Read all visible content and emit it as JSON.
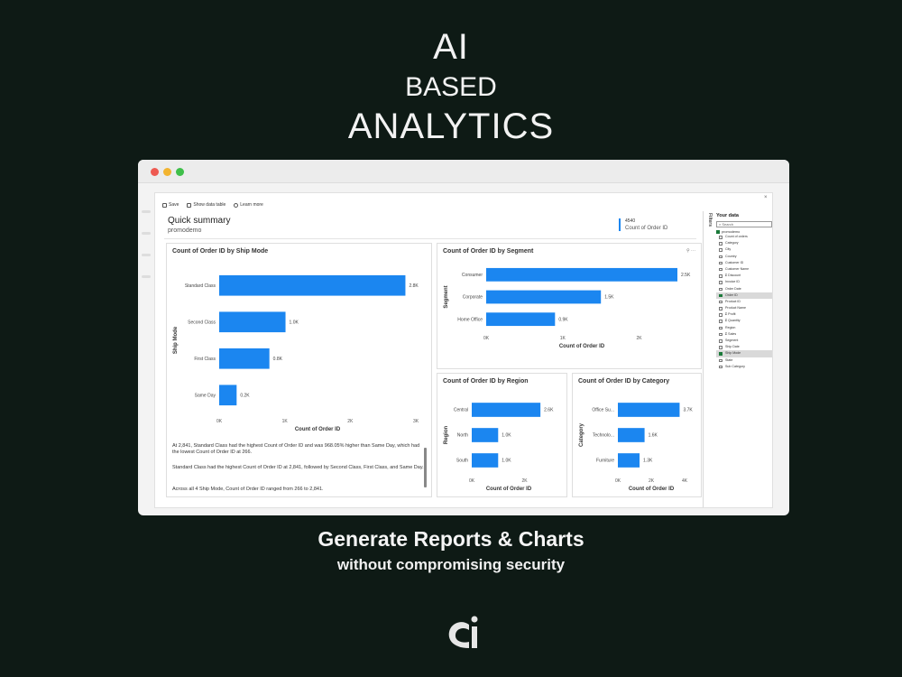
{
  "hero": {
    "line1": "AI",
    "line2": "BASED",
    "line3": "ANALYTICS"
  },
  "tagline": {
    "main": "Generate Reports & Charts",
    "sub": "without compromising security"
  },
  "colors": {
    "background": "#0e1a15",
    "bar": "#1b86f0",
    "table_icon": "#1b7a3a"
  },
  "toolbar": {
    "save": "Save",
    "show_data_table": "Show data table",
    "learn_more": "Learn more"
  },
  "summary": {
    "title": "Quick summary",
    "subtitle": "promodemo",
    "close": "×"
  },
  "kpi": {
    "value": "4540",
    "label": "Count of Order ID"
  },
  "insights": [
    "At 2,841, Standard Class had the highest Count of Order ID and was 968.05% higher than Same Day, which had the lowest Count of Order ID at 266.",
    "Standard Class had the highest Count of Order ID at 2,841, followed by Second Class, First Class, and Same Day.",
    "Across all 4 Ship Mode, Count of Order ID ranged from 266 to 2,841."
  ],
  "card_tools": "⚲  ···",
  "chart_data": [
    {
      "type": "bar",
      "orientation": "horizontal",
      "title": "Count of Order ID by Ship Mode",
      "ylabel": "Ship Mode",
      "xlabel": "Count of Order ID",
      "categories": [
        "Standard Class",
        "Second Class",
        "First Class",
        "Same Day"
      ],
      "values": [
        2841,
        1012,
        766,
        266
      ],
      "data_labels": [
        "2.8K",
        "1.0K",
        "0.8K",
        "0.2K"
      ],
      "xlim": [
        0,
        3000
      ],
      "ticks": [
        0,
        1000,
        2000,
        3000
      ],
      "tick_labels": [
        "0K",
        "1K",
        "2K",
        "3K"
      ]
    },
    {
      "type": "bar",
      "orientation": "horizontal",
      "title": "Count of Order ID by Segment",
      "ylabel": "Segment",
      "xlabel": "Count of Order ID",
      "categories": [
        "Consumer",
        "Corporate",
        "Home Office"
      ],
      "values": [
        2500,
        1500,
        900
      ],
      "data_labels": [
        "2.5K",
        "1.5K",
        "0.9K"
      ],
      "xlim": [
        0,
        2500
      ],
      "ticks": [
        0,
        1000,
        2000
      ],
      "tick_labels": [
        "0K",
        "1K",
        "2K"
      ]
    },
    {
      "type": "bar",
      "orientation": "horizontal",
      "title": "Count of Order ID by Region",
      "ylabel": "Region",
      "xlabel": "Count of Order ID",
      "categories": [
        "Central",
        "North",
        "South"
      ],
      "values": [
        2600,
        1000,
        1000
      ],
      "data_labels": [
        "2.6K",
        "1.0K",
        "1.0K"
      ],
      "xlim": [
        0,
        2800
      ],
      "ticks": [
        0,
        2000
      ],
      "tick_labels": [
        "0K",
        "2K"
      ]
    },
    {
      "type": "bar",
      "orientation": "horizontal",
      "title": "Count of Order ID by Category",
      "ylabel": "Category",
      "xlabel": "Count of Order ID",
      "categories": [
        "Office Su...",
        "Technolo...",
        "Furniture"
      ],
      "values": [
        3700,
        1600,
        1300
      ],
      "data_labels": [
        "3.7K",
        "1.6K",
        "1.3K"
      ],
      "xlim": [
        0,
        4000
      ],
      "ticks": [
        0,
        2000,
        4000
      ],
      "tick_labels": [
        "0K",
        "2K",
        "4K"
      ]
    }
  ],
  "fields_pane": {
    "tab_label": "Filters",
    "title": "Your data",
    "search_placeholder": "Search",
    "table_name": "promodemo",
    "fields": [
      {
        "name": "Count of orders",
        "checked": false,
        "sigma": false
      },
      {
        "name": "Category",
        "checked": false,
        "sigma": false
      },
      {
        "name": "City",
        "checked": false,
        "sigma": false
      },
      {
        "name": "Country",
        "checked": false,
        "sigma": false
      },
      {
        "name": "Customer ID",
        "checked": false,
        "sigma": false
      },
      {
        "name": "Customer Name",
        "checked": false,
        "sigma": false
      },
      {
        "name": "Discount",
        "checked": false,
        "sigma": true
      },
      {
        "name": "Invoice ID",
        "checked": false,
        "sigma": false
      },
      {
        "name": "Order Date",
        "checked": false,
        "sigma": false
      },
      {
        "name": "Order ID",
        "checked": true,
        "sigma": false
      },
      {
        "name": "Product ID",
        "checked": false,
        "sigma": false
      },
      {
        "name": "Product Name",
        "checked": false,
        "sigma": false
      },
      {
        "name": "Profit",
        "checked": false,
        "sigma": true
      },
      {
        "name": "Quantity",
        "checked": false,
        "sigma": true
      },
      {
        "name": "Region",
        "checked": false,
        "sigma": false
      },
      {
        "name": "Sales",
        "checked": false,
        "sigma": true
      },
      {
        "name": "Segment",
        "checked": false,
        "sigma": false
      },
      {
        "name": "Ship Date",
        "checked": false,
        "sigma": false
      },
      {
        "name": "Ship Mode",
        "checked": true,
        "sigma": false
      },
      {
        "name": "State",
        "checked": false,
        "sigma": false
      },
      {
        "name": "Sub Category",
        "checked": false,
        "sigma": false
      }
    ]
  }
}
